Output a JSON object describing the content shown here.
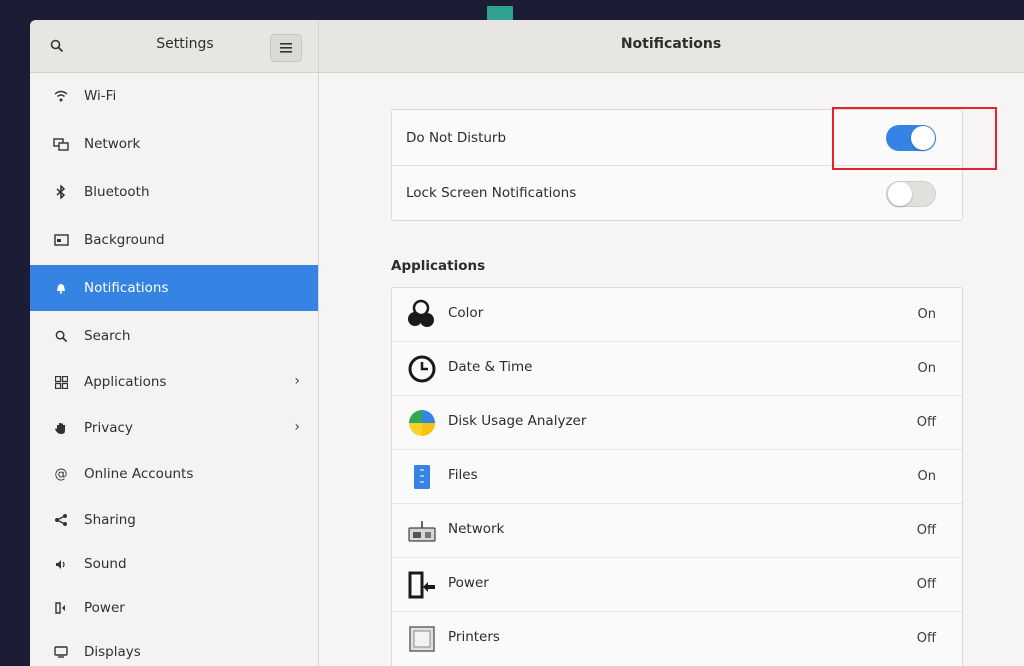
{
  "window": {
    "sidebar_title": "Settings",
    "main_title": "Notifications",
    "search_icon": "search-icon",
    "menu_icon": "hamburger-menu-icon"
  },
  "sidebar": {
    "items": [
      {
        "label": "Wi-Fi",
        "icon": "wifi-icon",
        "chevron": false,
        "selected": false
      },
      {
        "label": "Network",
        "icon": "network-icon",
        "chevron": false,
        "selected": false
      },
      {
        "label": "Bluetooth",
        "icon": "bluetooth-icon",
        "chevron": false,
        "selected": false
      },
      {
        "label": "Background",
        "icon": "background-icon",
        "chevron": false,
        "selected": false
      },
      {
        "label": "Notifications",
        "icon": "bell-icon",
        "chevron": false,
        "selected": true
      },
      {
        "label": "Search",
        "icon": "search-icon",
        "chevron": false,
        "selected": false
      },
      {
        "label": "Applications",
        "icon": "applications-icon",
        "chevron": true,
        "selected": false
      },
      {
        "label": "Privacy",
        "icon": "hand-icon",
        "chevron": true,
        "selected": false
      },
      {
        "label": "Online Accounts",
        "icon": "at-icon",
        "chevron": false,
        "selected": false
      },
      {
        "label": "Sharing",
        "icon": "share-icon",
        "chevron": false,
        "selected": false
      },
      {
        "label": "Sound",
        "icon": "speaker-icon",
        "chevron": false,
        "selected": false
      },
      {
        "label": "Power",
        "icon": "power-icon",
        "chevron": false,
        "selected": false
      },
      {
        "label": "Displays",
        "icon": "display-icon",
        "chevron": false,
        "selected": false
      }
    ]
  },
  "settings": {
    "do_not_disturb": {
      "label": "Do Not Disturb",
      "enabled": true
    },
    "lock_screen": {
      "label": "Lock Screen Notifications",
      "enabled": false
    }
  },
  "applications": {
    "heading": "Applications",
    "items": [
      {
        "name": "Color",
        "state": "On",
        "icon": "color-icon"
      },
      {
        "name": "Date & Time",
        "state": "On",
        "icon": "clock-icon"
      },
      {
        "name": "Disk Usage Analyzer",
        "state": "Off",
        "icon": "disk-usage-icon"
      },
      {
        "name": "Files",
        "state": "On",
        "icon": "files-icon"
      },
      {
        "name": "Network",
        "state": "Off",
        "icon": "network-app-icon"
      },
      {
        "name": "Power",
        "state": "Off",
        "icon": "power-app-icon"
      },
      {
        "name": "Printers",
        "state": "Off",
        "icon": "printer-icon"
      }
    ]
  },
  "colors": {
    "accent": "#3584e4",
    "highlight": "#e8212a"
  }
}
